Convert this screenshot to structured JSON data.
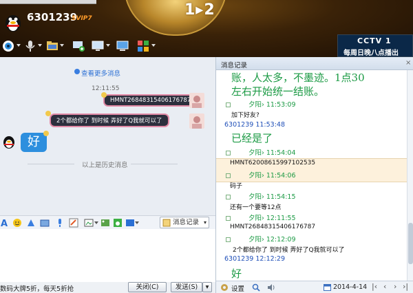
{
  "window": {
    "qq_number": "6301239",
    "vip_badge": "SVIP7",
    "banner_medal": "1▸2",
    "cctv": {
      "logo": "CCTV 1",
      "text": "每周日晚八点播出"
    }
  },
  "chat": {
    "more_messages": "查看更多消息",
    "timestamp": "12:11:55",
    "messages_out": [
      {
        "text": "HMNT26848315406176787"
      },
      {
        "text": "2个都给你了  到时候 弄好了Q我就可以了"
      }
    ],
    "message_in": "好",
    "history_divider": "以上是历史消息"
  },
  "input_toolbar": {
    "message_record_label": "消息记录"
  },
  "bottom": {
    "promo": "数码大牌5折，每天5折抢",
    "close_label": "关闭(C)",
    "send_label": "发送(S)"
  },
  "history": {
    "title": "消息记录",
    "close_glyph": "×",
    "entries": [
      {
        "kind": "big",
        "text": "账，人太多，不墨迹。1点30"
      },
      {
        "kind": "big",
        "text": "左右开始统一结账。"
      },
      {
        "kind": "hdr",
        "text": "夕阳› 11:53:09"
      },
      {
        "kind": "plain",
        "text": "加下好友?"
      },
      {
        "kind": "hdr-blue",
        "text": "6301239 11:53:48"
      },
      {
        "kind": "big",
        "text": "已经是了"
      },
      {
        "kind": "hdr",
        "text": "夕阳› 11:54:04"
      },
      {
        "kind": "plain",
        "text": "HMNT62008615997102535"
      },
      {
        "kind": "hdr",
        "text": "夕阳› 11:54:06"
      },
      {
        "kind": "plain",
        "text": "码子"
      },
      {
        "kind": "hdr",
        "text": "夕阳› 11:54:15"
      },
      {
        "kind": "plain",
        "text": "还有一个要等12点"
      },
      {
        "kind": "hdr",
        "text": "夕阳› 12:11:55"
      },
      {
        "kind": "plain",
        "text": "HMNT26848315406176787"
      },
      {
        "kind": "hdr",
        "text": "夕阳› 12:12:09"
      },
      {
        "kind": "plain",
        "text": "2个都给你了  到时候 弄好了Q我就可以了"
      },
      {
        "kind": "hdr-blue",
        "text": "6301239 12:12:29"
      },
      {
        "kind": "big",
        "text": "好"
      }
    ],
    "settings_label": "设置",
    "date": "2014-4-14"
  },
  "colors": {
    "sent_bubble_bg": "#2c2f3d",
    "sent_bubble_border": "#e28aa6",
    "received_bubble_bg": "#2d8fde",
    "history_green": "#1b9a44",
    "history_blue": "#1f4fb8",
    "highlight_row": "#fdf1dc"
  }
}
